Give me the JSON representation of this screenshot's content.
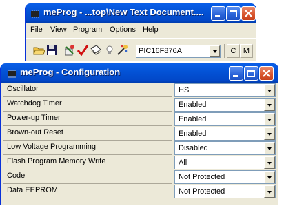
{
  "main_window": {
    "title": "meProg - ...top\\New Text Document....",
    "menu": [
      "File",
      "View",
      "Program",
      "Options",
      "Help"
    ],
    "device_select": {
      "value": "PIC16F876A"
    },
    "toolbar_buttons": {
      "c_label": "C",
      "m_label": "M"
    },
    "icons": [
      "open-folder-icon",
      "save-disk-icon",
      "config-icon",
      "verify-check-icon",
      "read-chip-icon",
      "bulb-icon",
      "erase-wand-icon"
    ]
  },
  "config_window": {
    "title": "meProg - Configuration",
    "rows": [
      {
        "label": "Oscillator",
        "value": "HS"
      },
      {
        "label": "Watchdog Timer",
        "value": "Enabled"
      },
      {
        "label": "Power-up Timer",
        "value": "Enabled"
      },
      {
        "label": "Brown-out Reset",
        "value": "Enabled"
      },
      {
        "label": "Low Voltage Programming",
        "value": "Disabled"
      },
      {
        "label": "Flash Program Memory Write",
        "value": "All"
      },
      {
        "label": "Code",
        "value": "Not Protected"
      },
      {
        "label": "Data EEPROM",
        "value": "Not Protected"
      }
    ]
  },
  "colors": {
    "titlebar": "#0353d6",
    "window_face": "#ece9d8",
    "close": "#d8552e"
  }
}
